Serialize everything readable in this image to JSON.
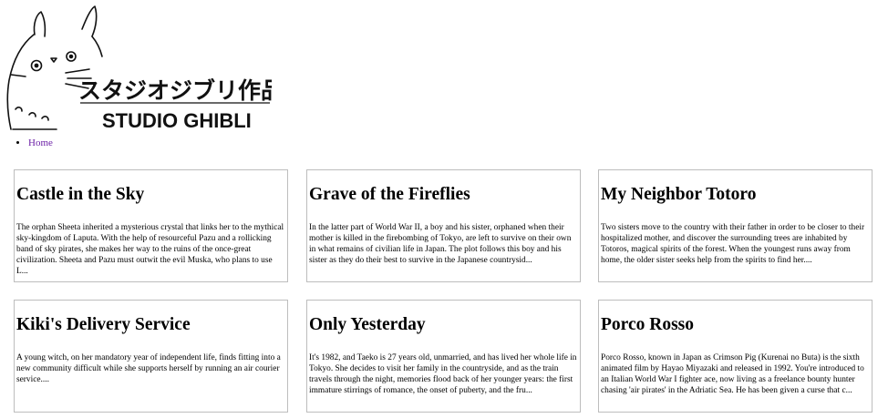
{
  "logo": {
    "japanese": "スタジオジブリ作品",
    "english": "STUDIO GHIBLI",
    "link_color": "#6b1fa6"
  },
  "nav": {
    "items": [
      {
        "label": "Home"
      }
    ]
  },
  "films": [
    {
      "title": "Castle in the Sky",
      "description": "The orphan Sheeta inherited a mysterious crystal that links her to the mythical sky-kingdom of Laputa. With the help of resourceful Pazu and a rollicking band of sky pirates, she makes her way to the ruins of the once-great civilization. Sheeta and Pazu must outwit the evil Muska, who plans to use L..."
    },
    {
      "title": "Grave of the Fireflies",
      "description": "In the latter part of World War II, a boy and his sister, orphaned when their mother is killed in the firebombing of Tokyo, are left to survive on their own in what remains of civilian life in Japan. The plot follows this boy and his sister as they do their best to survive in the Japanese countrysid..."
    },
    {
      "title": "My Neighbor Totoro",
      "description": "Two sisters move to the country with their father in order to be closer to their hospitalized mother, and discover the surrounding trees are inhabited by Totoros, magical spirits of the forest. When the youngest runs away from home, the older sister seeks help from the spirits to find her...."
    },
    {
      "title": "Kiki's Delivery Service",
      "description": "A young witch, on her mandatory year of independent life, finds fitting into a new community difficult while she supports herself by running an air courier service...."
    },
    {
      "title": "Only Yesterday",
      "description": "It's 1982, and Taeko is 27 years old, unmarried, and has lived her whole life in Tokyo. She decides to visit her family in the countryside, and as the train travels through the night, memories flood back of her younger years: the first immature stirrings of romance, the onset of puberty, and the fru..."
    },
    {
      "title": "Porco Rosso",
      "description": "Porco Rosso, known in Japan as Crimson Pig (Kurenai no Buta) is the sixth animated film by Hayao Miyazaki and released in 1992. You're introduced to an Italian World War I fighter ace, now living as a freelance bounty hunter chasing 'air pirates' in the Adriatic Sea. He has been given a curse that c..."
    }
  ]
}
